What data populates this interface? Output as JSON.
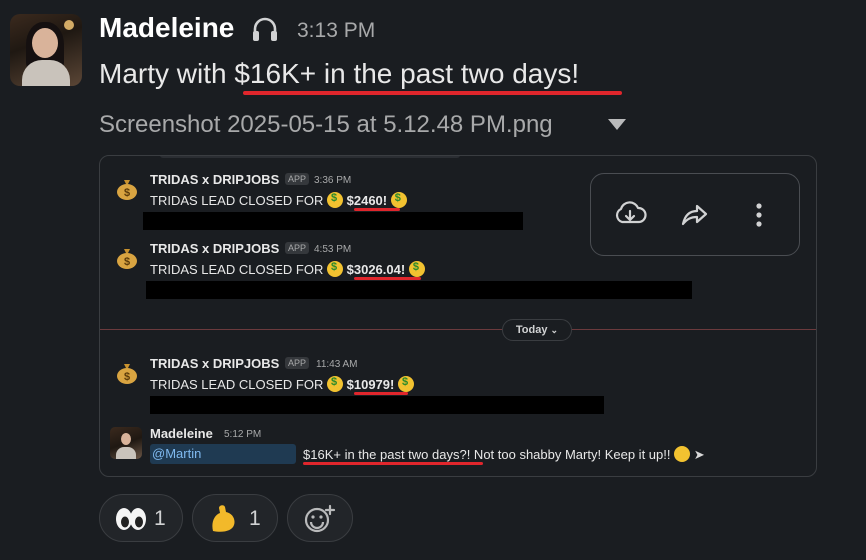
{
  "message": {
    "sender": "Madeleine",
    "time": "3:13 PM",
    "text_prefix": "Marty with ",
    "text_highlight": "$16K+ in the past two days!",
    "attachment_name": "Screenshot 2025-05-15 at 5.12.48 PM.png"
  },
  "screenshot": {
    "bot_messages": [
      {
        "name": "TRIDAS x DRIPJOBS",
        "badge": "APP",
        "time": "3:36 PM",
        "text": "TRIDAS LEAD CLOSED FOR",
        "amount": "$2460!"
      },
      {
        "name": "TRIDAS x DRIPJOBS",
        "badge": "APP",
        "time": "4:53 PM",
        "text": "TRIDAS LEAD CLOSED FOR",
        "amount": "$3026.04!"
      },
      {
        "name": "TRIDAS x DRIPJOBS",
        "badge": "APP",
        "time": "11:43 AM",
        "text": "TRIDAS LEAD CLOSED FOR",
        "amount": "$10979!"
      }
    ],
    "divider_label": "Today",
    "reply": {
      "name": "Madeleine",
      "time": "5:12 PM",
      "mention": "@Martin",
      "highlight": "$16K+ in the past two days?!",
      "rest": " Not too shabby Marty! Keep it up!!"
    }
  },
  "toolbar": [
    "download-icon",
    "share-icon",
    "more-icon"
  ],
  "reactions": [
    {
      "emoji": "eyes",
      "count": "1"
    },
    {
      "emoji": "flexed-biceps",
      "count": "1"
    }
  ],
  "colors": {
    "background": "#1a1d21",
    "underline": "#e0262c",
    "mention_bg": "#1f3a52"
  }
}
